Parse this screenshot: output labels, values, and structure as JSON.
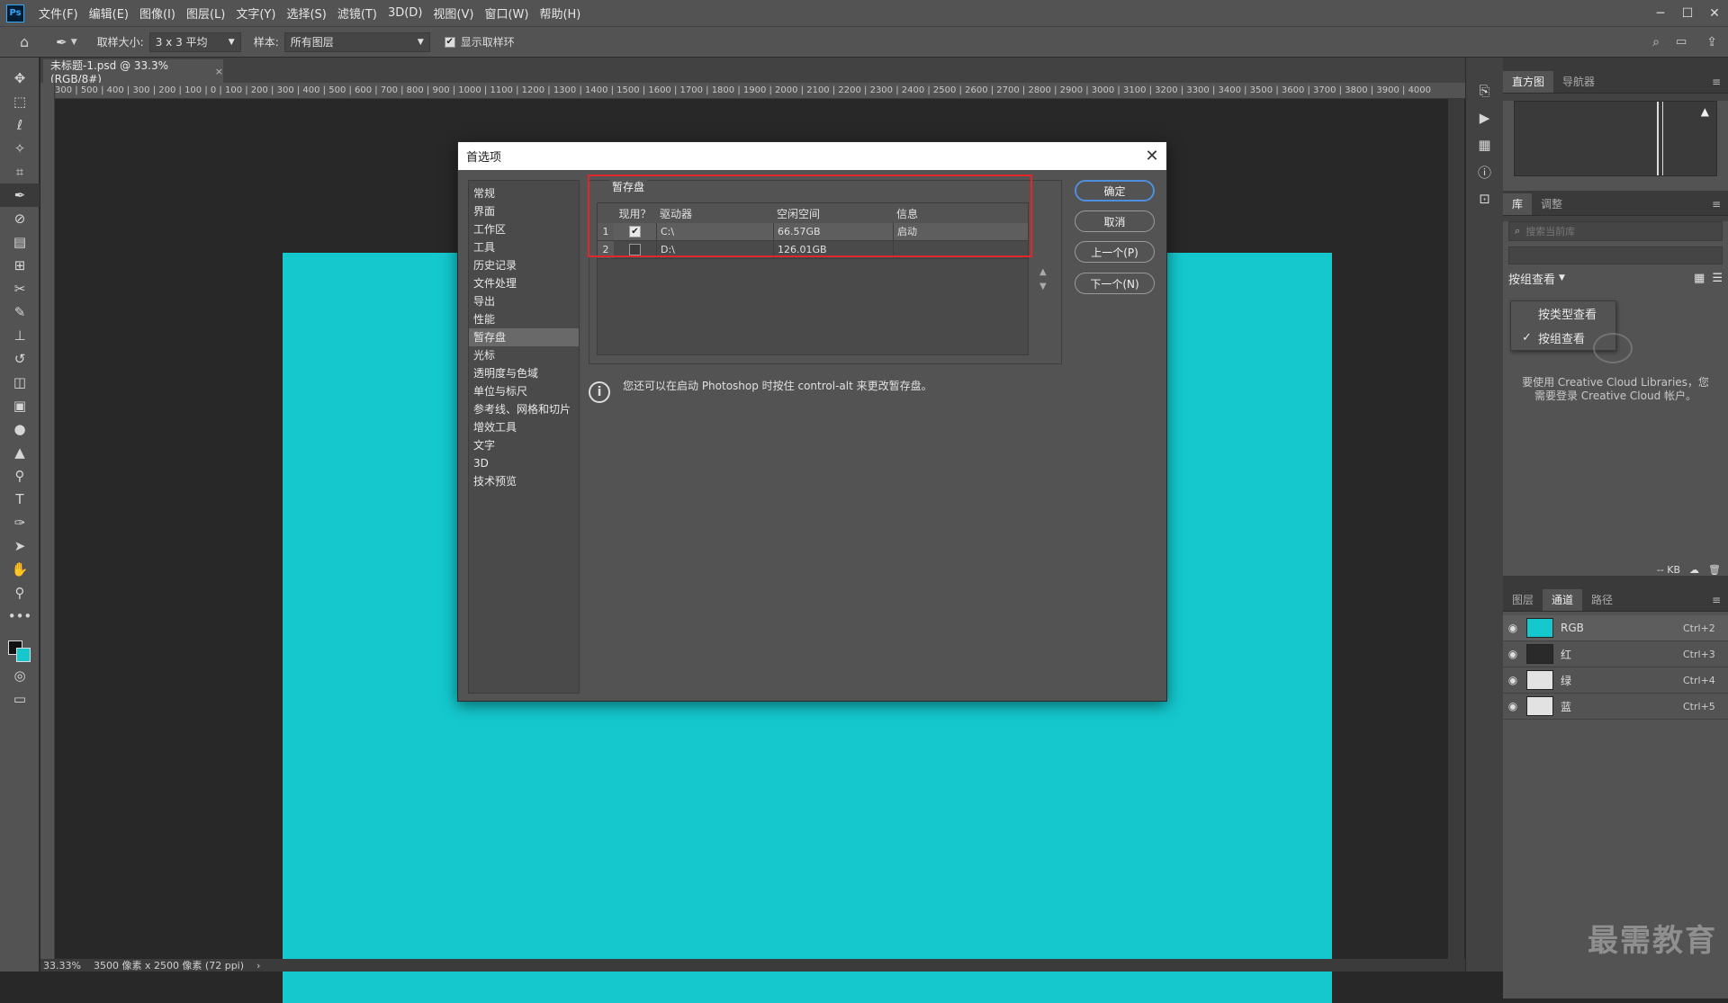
{
  "app": {
    "logo": "Ps"
  },
  "menu": [
    "文件(F)",
    "编辑(E)",
    "图像(I)",
    "图层(L)",
    "文字(Y)",
    "选择(S)",
    "滤镜(T)",
    "3D(D)",
    "视图(V)",
    "窗口(W)",
    "帮助(H)"
  ],
  "options": {
    "sample_size_label": "取样大小:",
    "sample_size_value": "3 x 3 平均",
    "sample_label": "样本:",
    "sample_value": "所有图层",
    "show_ring_label": "显示取样环"
  },
  "document": {
    "tab_title": "未标题-1.psd @ 33.3%(RGB/8#)",
    "canvas_color": "#14c8ce",
    "ruler_ticks": "300 | 500 | 400 | 300 | 200 | 100 | 0 | 100 | 200 | 300 | 400 | 500 | 600 | 700 | 800 | 900 | 1000 | 1100 | 1200 | 1300 | 1400 | 1500 | 1600 | 1700 | 1800 | 1900 | 2000 | 2100 | 2200 | 2300 | 2400 | 2500 | 2600 | 2700 | 2800 | 2900 | 3000 | 3100 | 3200 | 3300 | 3400 | 3500 | 3600 | 3700 | 3800 | 3900 | 4000"
  },
  "status": {
    "zoom": "33.33%",
    "size": "3500 像素 x 2500 像素 (72 ppi)"
  },
  "panels": {
    "top_tabs": [
      "直方图",
      "导航器"
    ],
    "lib_tabs": [
      "库",
      "调整"
    ],
    "lib_search_placeholder": "搜索当前库",
    "view_label": "按组查看",
    "dropdown": [
      "按类型查看",
      "按组查看"
    ],
    "lib_message": "要使用 Creative Cloud Libraries，您需要登录 Creative Cloud 帐户。",
    "lib_size": "-- KB",
    "bottom_tabs": [
      "图层",
      "通道",
      "路径"
    ],
    "channels": [
      {
        "name": "RGB",
        "key": "Ctrl+2",
        "color": "#14c8ce"
      },
      {
        "name": "红",
        "key": "Ctrl+3",
        "color": "#2a2a2a"
      },
      {
        "name": "绿",
        "key": "Ctrl+4",
        "color": "#e2e2e2"
      },
      {
        "name": "蓝",
        "key": "Ctrl+5",
        "color": "#e2e2e2"
      }
    ]
  },
  "dialog": {
    "title": "首选项",
    "nav": [
      "常规",
      "界面",
      "工作区",
      "工具",
      "历史记录",
      "文件处理",
      "导出",
      "性能",
      "暂存盘",
      "光标",
      "透明度与色域",
      "单位与标尺",
      "参考线、网格和切片",
      "增效工具",
      "文字",
      "3D",
      "技术预览"
    ],
    "nav_active_index": 8,
    "scratch_title": "暂存盘",
    "table_headers": [
      "现用？",
      "驱动器",
      "空闲空间",
      "信息"
    ],
    "rows": [
      {
        "idx": "1",
        "checked": true,
        "drive": "C:\\",
        "free": "66.57GB",
        "info": "启动"
      },
      {
        "idx": "2",
        "checked": false,
        "drive": "D:\\",
        "free": "126.01GB",
        "info": ""
      }
    ],
    "info_text": "您还可以在启动 Photoshop 时按住 control-alt 来更改暂存盘。",
    "buttons": {
      "ok": "确定",
      "cancel": "取消",
      "prev": "上一个(P)",
      "next": "下一个(N)"
    },
    "highlight_color": "#e0282c"
  },
  "watermark": "最需教育"
}
